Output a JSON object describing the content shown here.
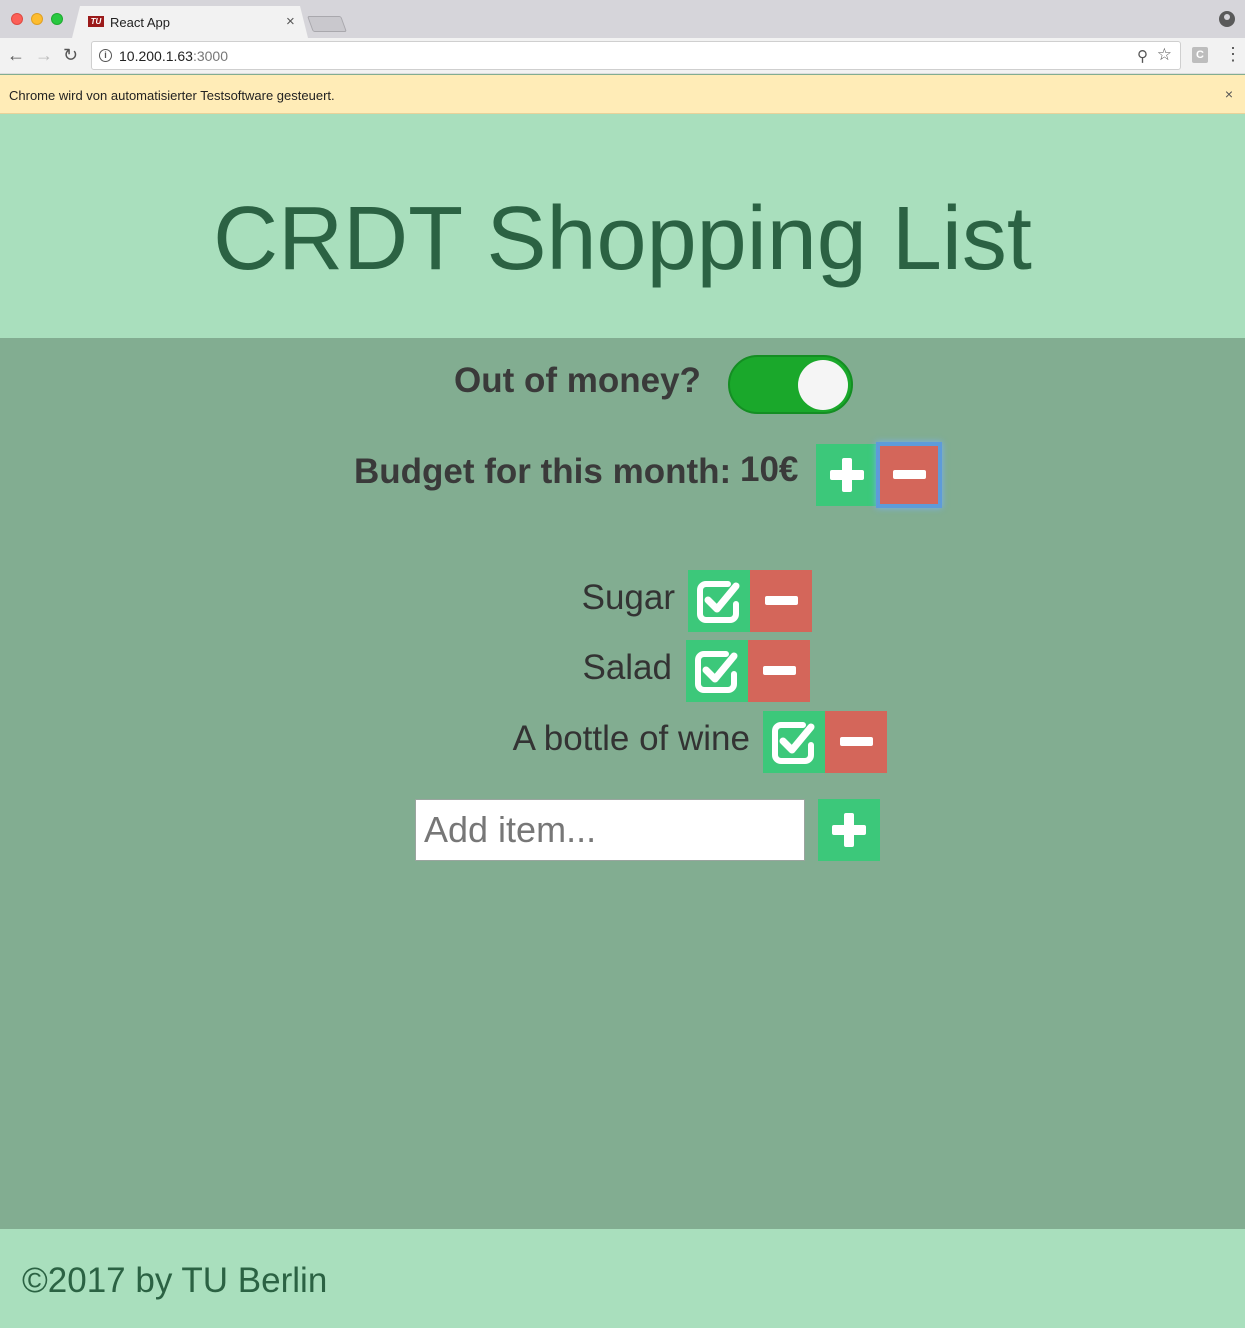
{
  "browser": {
    "tab_title": "React App",
    "tab_favicon": "TU",
    "tab_close": "×",
    "url_host": "10.200.1.63",
    "url_port": ":3000",
    "infobar_text": "Chrome wird von automatisierter Testsoftware gesteuert.",
    "infobar_close": "×",
    "extension_label": "C",
    "icons": [
      "back-icon",
      "forward-icon",
      "reload-icon",
      "info-icon",
      "zoom-icon",
      "star-icon",
      "menu-icon",
      "profile-icon"
    ]
  },
  "app": {
    "title": "CRDT Shopping List",
    "out_of_money_label": "Out of money?",
    "out_of_money_toggle_on": true,
    "budget_label": "Budget for this month:",
    "budget_value": "10€",
    "items": [
      {
        "label": "Sugar"
      },
      {
        "label": "Salad"
      },
      {
        "label": "A bottle of wine"
      }
    ],
    "add_item_placeholder": "Add item...",
    "footer": "©2017 by TU Berlin"
  },
  "colors": {
    "header_bg": "#a9dfbd",
    "main_bg": "#82ad91",
    "title_color": "#2b6243",
    "green_button": "#3cc87a",
    "red_button": "#d4665a",
    "toggle_on": "#1aa82b"
  }
}
